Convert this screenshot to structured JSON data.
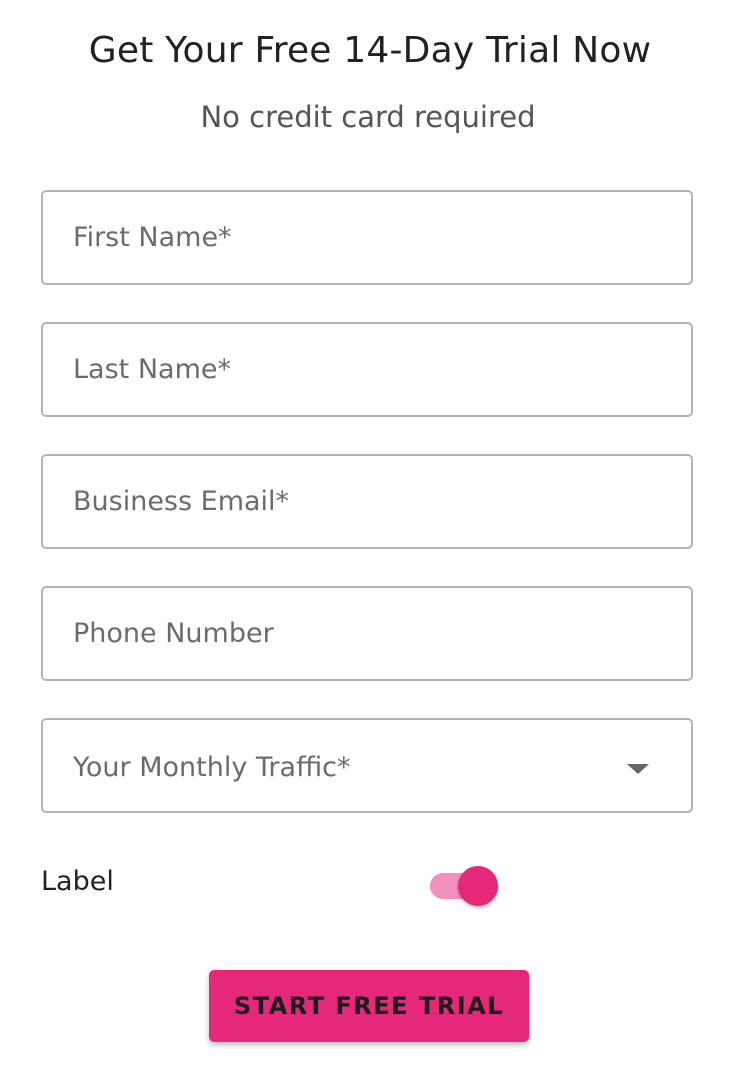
{
  "header": {
    "title": "Get Your Free 14-Day Trial Now",
    "subtitle": "No credit card required"
  },
  "form": {
    "first_name": {
      "placeholder": "First Name*",
      "value": ""
    },
    "last_name": {
      "placeholder": "Last Name*",
      "value": ""
    },
    "business_email": {
      "placeholder": "Business Email*",
      "value": ""
    },
    "phone_number": {
      "placeholder": "Phone Number",
      "value": ""
    },
    "monthly_traffic": {
      "label": "Your Monthly Traffic*",
      "icon": "chevron-down-icon"
    },
    "toggle": {
      "label": "Label",
      "on": true
    },
    "submit_label": "START FREE TRIAL"
  },
  "colors": {
    "accent": "#e5287a",
    "accent_light": "#f28fba",
    "border": "#b3b3b3",
    "text": "#222222",
    "muted": "#6b6b6b"
  }
}
